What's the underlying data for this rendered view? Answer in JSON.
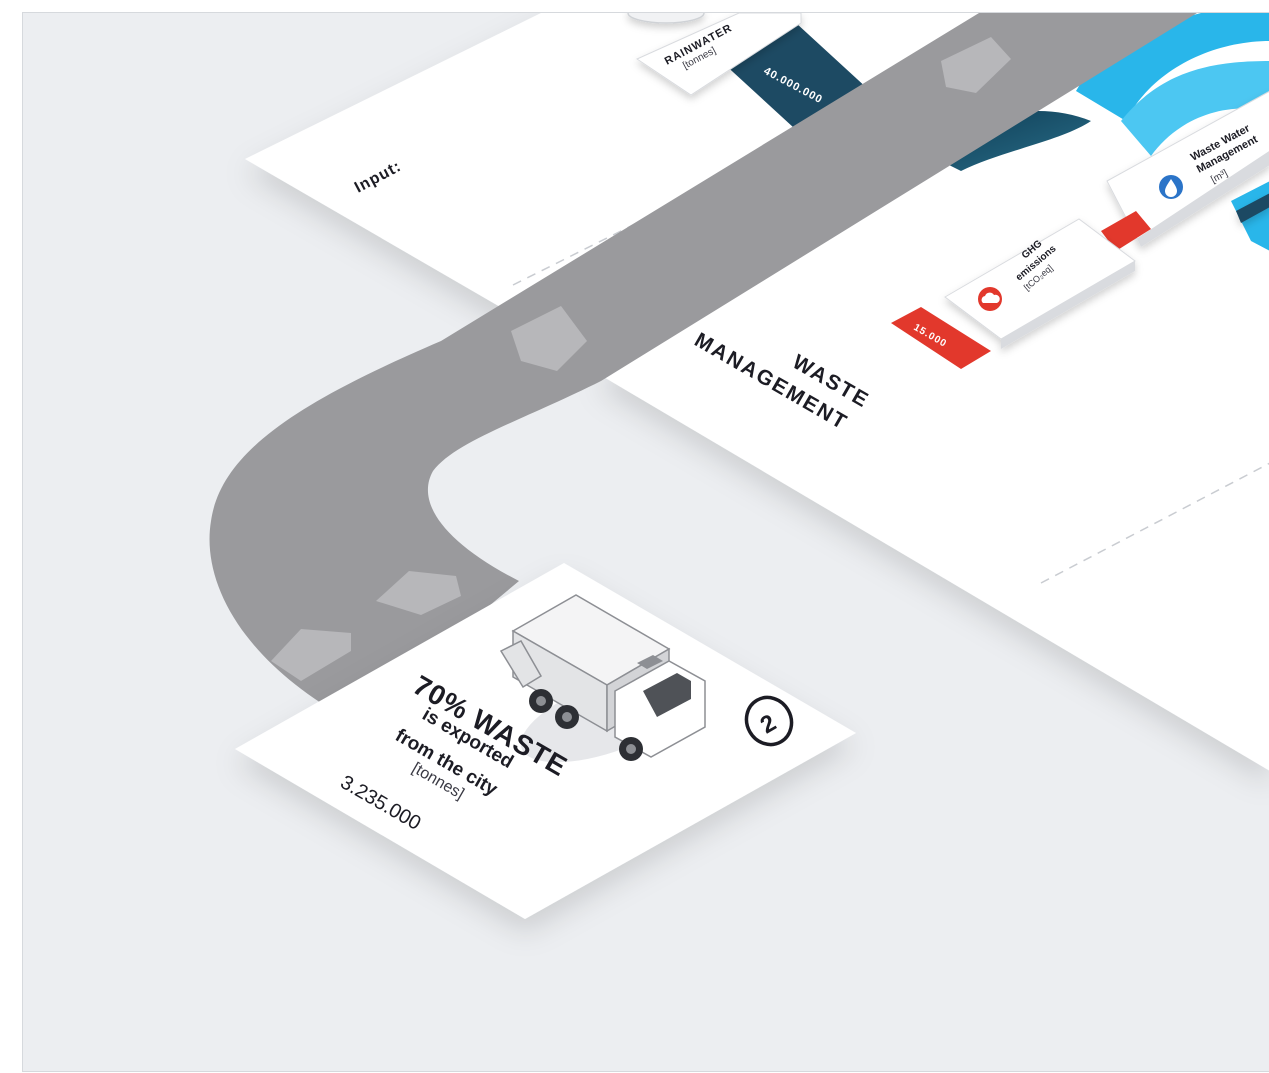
{
  "input_panel": {
    "label": "Input:",
    "rainwater_title": "RAINWATER",
    "rainwater_unit": "[tonnes]",
    "rainwater_value": "40.000.000"
  },
  "waste_panel": {
    "title_line1": "WASTE",
    "title_line2": "MANAGEMENT",
    "ghg_title": "GHG",
    "ghg_line2": "emissions",
    "ghg_unit": "[tCO₂eq]",
    "ghg_value": "15.000",
    "wastewater_line1": "Waste Water",
    "wastewater_line2": "Management",
    "wastewater_unit": "[m³]"
  },
  "export_card": {
    "headline": "70% WASTE",
    "line2": "is exported",
    "line3": "from the city",
    "unit": "[tonnes]",
    "value": "3.235.000",
    "step_number": "2"
  },
  "colors": {
    "background": "#eceef1",
    "road": "#9a9a9d",
    "dark_teal": "#1d4a63",
    "blue": "#29b6ea",
    "red": "#e2382c",
    "panel": "#ffffff"
  },
  "icons": [
    "truck-icon",
    "cloud-icon",
    "droplet-icon",
    "step-marker-icon"
  ]
}
